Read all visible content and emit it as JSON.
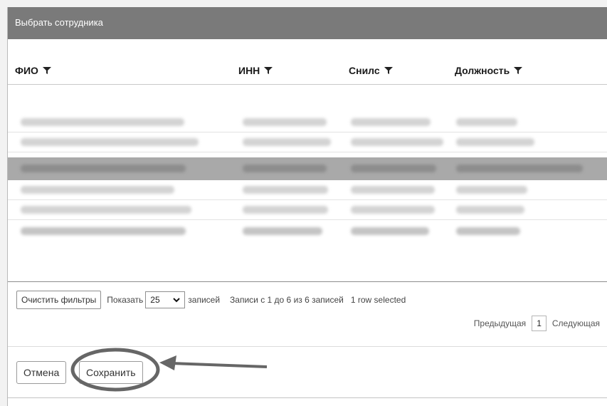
{
  "dialog": {
    "title": "Выбрать сотрудника"
  },
  "table": {
    "columns": [
      {
        "label": "ФИО",
        "filter_icon": "filter-icon"
      },
      {
        "label": "ИНН",
        "filter_icon": "filter-icon"
      },
      {
        "label": "Снилс",
        "filter_icon": "filter-icon"
      },
      {
        "label": "Должность",
        "filter_icon": "filter-icon"
      }
    ],
    "rows_note": "row contents are blurred/illegible in the screenshot",
    "selected_row_index": 2
  },
  "controls": {
    "clear_filters_label": "Очистить фильтры",
    "show_label": "Показать",
    "page_size_value": "25",
    "records_label": "записей",
    "info_text": "Записи с 1 до 6 из 6 записей",
    "selected_text": "1 row selected"
  },
  "pager": {
    "prev_label": "Предыдущая",
    "page": "1",
    "next_label": "Следующая"
  },
  "footer": {
    "cancel_label": "Отмена",
    "save_label": "Сохранить"
  },
  "colors": {
    "header_bg": "#7a7a7a",
    "selected_row": "#a9a9a9",
    "annotation": "#666666"
  }
}
